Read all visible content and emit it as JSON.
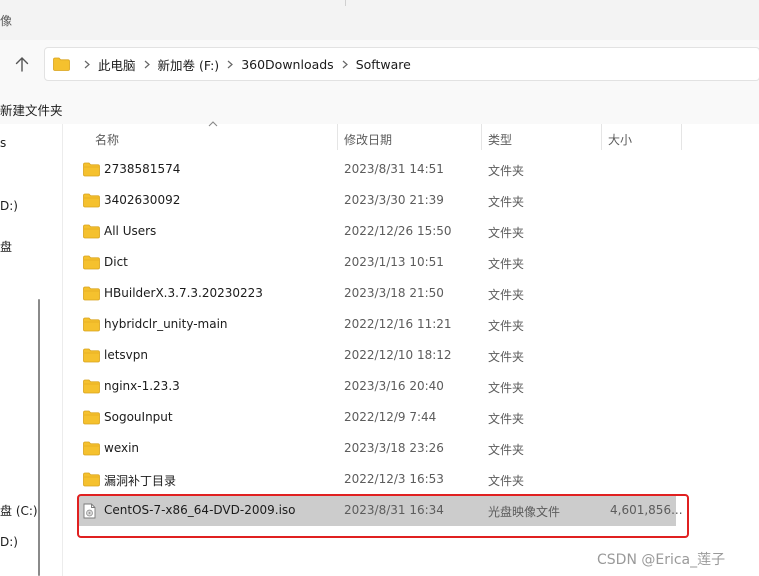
{
  "window": {
    "title": "像"
  },
  "address": {
    "crumbs": [
      "此电脑",
      "新加卷 (F:)",
      "360Downloads",
      "Software"
    ]
  },
  "toolbar": {
    "new_folder_label": "新建文件夹"
  },
  "nav": {
    "items": [
      "s",
      "D:)",
      "盘",
      "盘 (C:)",
      "D:)"
    ]
  },
  "columns": {
    "name": "名称",
    "date": "修改日期",
    "type": "类型",
    "size": "大小"
  },
  "files": [
    {
      "name": "2738581574",
      "date": "2023/8/31 14:51",
      "type": "文件夹",
      "size": ""
    },
    {
      "name": "3402630092",
      "date": "2023/3/30 21:39",
      "type": "文件夹",
      "size": ""
    },
    {
      "name": "All Users",
      "date": "2022/12/26 15:50",
      "type": "文件夹",
      "size": ""
    },
    {
      "name": "Dict",
      "date": "2023/1/13 10:51",
      "type": "文件夹",
      "size": ""
    },
    {
      "name": "HBuilderX.3.7.3.20230223",
      "date": "2023/3/18 21:50",
      "type": "文件夹",
      "size": ""
    },
    {
      "name": "hybridclr_unity-main",
      "date": "2022/12/16 11:21",
      "type": "文件夹",
      "size": ""
    },
    {
      "name": "letsvpn",
      "date": "2022/12/10 18:12",
      "type": "文件夹",
      "size": ""
    },
    {
      "name": "nginx-1.23.3",
      "date": "2023/3/16 20:40",
      "type": "文件夹",
      "size": ""
    },
    {
      "name": "SogouInput",
      "date": "2022/12/9 7:44",
      "type": "文件夹",
      "size": ""
    },
    {
      "name": "wexin",
      "date": "2023/3/18 23:26",
      "type": "文件夹",
      "size": ""
    },
    {
      "name": "漏洞补丁目录",
      "date": "2022/12/3 16:53",
      "type": "文件夹",
      "size": ""
    },
    {
      "name": "CentOS-7-x86_64-DVD-2009.iso",
      "date": "2023/8/31 16:34",
      "type": "光盘映像文件",
      "size": "4,601,856..."
    }
  ],
  "selected_file": "CentOS-7-x86_64-DVD-2009.iso",
  "watermark": "CSDN @Erica_莲子",
  "colors": {
    "folder": "#f5c12e",
    "selection": "#cccccc",
    "highlight_border": "#e02020"
  },
  "icons": {
    "up": "arrow-up-icon",
    "folder": "folder-icon",
    "file": "disc-image-icon",
    "chevron": "chevron-right-icon"
  }
}
